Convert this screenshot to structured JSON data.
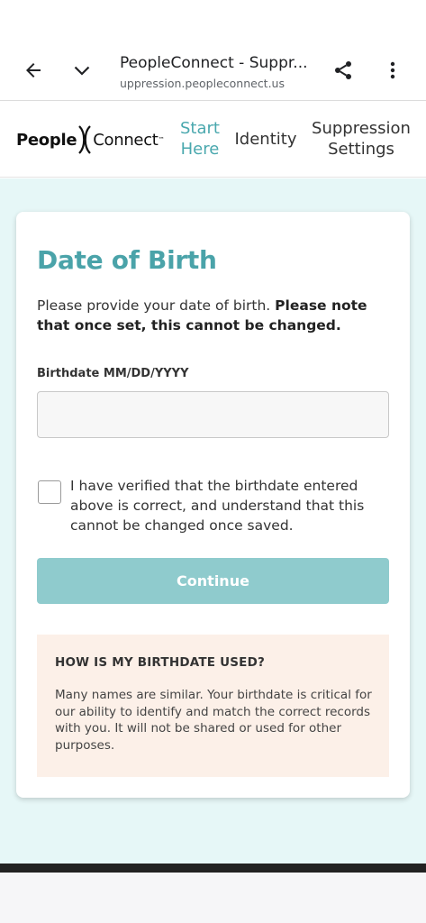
{
  "browser": {
    "tab_title": "PeopleConnect - Suppr...",
    "url": "uppression.peopleconnect.us"
  },
  "site": {
    "logo_people": "People",
    "logo_connect": "Connect",
    "logo_tm": "™",
    "nav": {
      "start_here": "Start Here",
      "identity": "Identity",
      "suppression_settings": "Suppression Settings"
    }
  },
  "form": {
    "heading": "Date of Birth",
    "intro_plain": "Please provide your date of birth. ",
    "intro_bold": "Please note that once set, this cannot be changed.",
    "field_label": "Birthdate MM/DD/YYYY",
    "input_value": "",
    "checkbox_checked": false,
    "checkbox_label": "I have verified that the birthdate entered above is correct, and understand that this cannot be changed once saved.",
    "continue_label": "Continue",
    "continue_enabled": false
  },
  "info": {
    "title": "HOW IS MY BIRTHDATE USED?",
    "text": "Many names are similar. Your birthdate is critical for our ability to identify and match the correct records with you. It will not be shared or used for other purposes."
  },
  "colors": {
    "accent": "#4aa3a9",
    "button_disabled": "#8fcbcd",
    "page_background": "#e6f7f7",
    "info_background": "#fcf0e8"
  },
  "icons": {
    "back": "arrow-left-icon",
    "tabs": "chevron-down-icon",
    "share": "share-icon",
    "menu": "more-vert-icon"
  }
}
